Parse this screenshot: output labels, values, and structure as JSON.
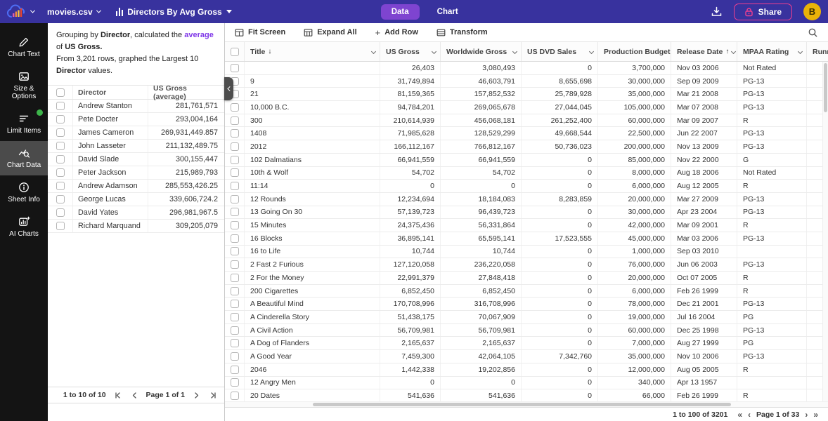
{
  "topbar": {
    "file_name": "movies.csv",
    "chart_name": "Directors By Avg Gross",
    "tabs": [
      {
        "label": "Data",
        "active": true
      },
      {
        "label": "Chart",
        "active": false
      }
    ],
    "share_label": "Share",
    "avatar_initial": "B"
  },
  "sidebar": {
    "items": [
      {
        "label": "Chart Text",
        "icon": "pencil-icon",
        "active": false,
        "badge": false
      },
      {
        "label": "Size & Options",
        "icon": "image-icon",
        "active": false,
        "badge": false
      },
      {
        "label": "Limit Items",
        "icon": "filter-lines-icon",
        "active": false,
        "badge": true
      },
      {
        "label": "Chart Data",
        "icon": "chart-search-icon",
        "active": true,
        "badge": false
      },
      {
        "label": "Sheet Info",
        "icon": "info-icon",
        "active": false,
        "badge": false
      },
      {
        "label": "AI Charts",
        "icon": "ai-chart-icon",
        "active": false,
        "badge": false
      }
    ]
  },
  "summary": {
    "seg1": "Grouping by ",
    "seg2": "Director",
    "seg3": ", calculated the ",
    "seg4": "average",
    "seg5": " of ",
    "seg6": "US Gross",
    "seg7": ".",
    "seg8": "From 3,201 rows, graphed the Largest 10 ",
    "seg9": "Director",
    "seg10": " values."
  },
  "group_table": {
    "columns": [
      "Director",
      "US Gross (average)"
    ],
    "rows": [
      [
        "Andrew Stanton",
        "281,761,571"
      ],
      [
        "Pete Docter",
        "293,004,164"
      ],
      [
        "James Cameron",
        "269,931,449.857"
      ],
      [
        "John Lasseter",
        "211,132,489.75"
      ],
      [
        "David Slade",
        "300,155,447"
      ],
      [
        "Peter Jackson",
        "215,989,793"
      ],
      [
        "Andrew Adamson",
        "285,553,426.25"
      ],
      [
        "George Lucas",
        "339,606,724.2"
      ],
      [
        "David Yates",
        "296,981,967.5"
      ],
      [
        "Richard Marquand",
        "309,205,079"
      ]
    ],
    "pagination": {
      "range": "1 to 10 of 10",
      "page": "Page 1 of 1"
    }
  },
  "toolbar": {
    "buttons": [
      "Fit Screen",
      "Expand All",
      "Add Row",
      "Transform"
    ]
  },
  "data_table": {
    "columns": [
      {
        "label": "Title",
        "sort": "desc"
      },
      {
        "label": "US Gross"
      },
      {
        "label": "Worldwide Gross"
      },
      {
        "label": "US DVD Sales"
      },
      {
        "label": "Production Budget"
      },
      {
        "label": "Release Date",
        "sort": "asc"
      },
      {
        "label": "MPAA Rating"
      },
      {
        "label": "Runn",
        "truncated": true
      }
    ],
    "rows": [
      [
        "",
        "26,403",
        "3,080,493",
        "0",
        "3,700,000",
        "Nov 03 2006",
        "Not Rated",
        ""
      ],
      [
        "9",
        "31,749,894",
        "46,603,791",
        "8,655,698",
        "30,000,000",
        "Sep 09 2009",
        "PG-13",
        ""
      ],
      [
        "21",
        "81,159,365",
        "157,852,532",
        "25,789,928",
        "35,000,000",
        "Mar 21 2008",
        "PG-13",
        ""
      ],
      [
        "10,000 B.C.",
        "94,784,201",
        "269,065,678",
        "27,044,045",
        "105,000,000",
        "Mar 07 2008",
        "PG-13",
        ""
      ],
      [
        "300",
        "210,614,939",
        "456,068,181",
        "261,252,400",
        "60,000,000",
        "Mar 09 2007",
        "R",
        ""
      ],
      [
        "1408",
        "71,985,628",
        "128,529,299",
        "49,668,544",
        "22,500,000",
        "Jun 22 2007",
        "PG-13",
        ""
      ],
      [
        "2012",
        "166,112,167",
        "766,812,167",
        "50,736,023",
        "200,000,000",
        "Nov 13 2009",
        "PG-13",
        ""
      ],
      [
        "102 Dalmatians",
        "66,941,559",
        "66,941,559",
        "0",
        "85,000,000",
        "Nov 22 2000",
        "G",
        ""
      ],
      [
        "10th & Wolf",
        "54,702",
        "54,702",
        "0",
        "8,000,000",
        "Aug 18 2006",
        "Not Rated",
        ""
      ],
      [
        "11:14",
        "0",
        "0",
        "0",
        "6,000,000",
        "Aug 12 2005",
        "R",
        ""
      ],
      [
        "12 Rounds",
        "12,234,694",
        "18,184,083",
        "8,283,859",
        "20,000,000",
        "Mar 27 2009",
        "PG-13",
        ""
      ],
      [
        "13 Going On 30",
        "57,139,723",
        "96,439,723",
        "0",
        "30,000,000",
        "Apr 23 2004",
        "PG-13",
        ""
      ],
      [
        "15 Minutes",
        "24,375,436",
        "56,331,864",
        "0",
        "42,000,000",
        "Mar 09 2001",
        "R",
        ""
      ],
      [
        "16 Blocks",
        "36,895,141",
        "65,595,141",
        "17,523,555",
        "45,000,000",
        "Mar 03 2006",
        "PG-13",
        ""
      ],
      [
        "16 to Life",
        "10,744",
        "10,744",
        "0",
        "1,000,000",
        "Sep 03 2010",
        "",
        ""
      ],
      [
        "2 Fast 2 Furious",
        "127,120,058",
        "236,220,058",
        "0",
        "76,000,000",
        "Jun 06 2003",
        "PG-13",
        ""
      ],
      [
        "2 For the Money",
        "22,991,379",
        "27,848,418",
        "0",
        "20,000,000",
        "Oct 07 2005",
        "R",
        ""
      ],
      [
        "200 Cigarettes",
        "6,852,450",
        "6,852,450",
        "0",
        "6,000,000",
        "Feb 26 1999",
        "R",
        ""
      ],
      [
        "A Beautiful Mind",
        "170,708,996",
        "316,708,996",
        "0",
        "78,000,000",
        "Dec 21 2001",
        "PG-13",
        ""
      ],
      [
        "A Cinderella Story",
        "51,438,175",
        "70,067,909",
        "0",
        "19,000,000",
        "Jul 16 2004",
        "PG",
        ""
      ],
      [
        "A Civil Action",
        "56,709,981",
        "56,709,981",
        "0",
        "60,000,000",
        "Dec 25 1998",
        "PG-13",
        ""
      ],
      [
        "A Dog of Flanders",
        "2,165,637",
        "2,165,637",
        "0",
        "7,000,000",
        "Aug 27 1999",
        "PG",
        ""
      ],
      [
        "A Good Year",
        "7,459,300",
        "42,064,105",
        "7,342,760",
        "35,000,000",
        "Nov 10 2006",
        "PG-13",
        ""
      ],
      [
        "2046",
        "1,442,338",
        "19,202,856",
        "0",
        "12,000,000",
        "Aug 05 2005",
        "R",
        ""
      ],
      [
        "12 Angry Men",
        "0",
        "0",
        "0",
        "340,000",
        "Apr 13 1957",
        "",
        ""
      ],
      [
        "20 Dates",
        "541,636",
        "541,636",
        "0",
        "66,000",
        "Feb 26 1999",
        "R",
        ""
      ]
    ],
    "pagination": {
      "range": "1 to 100 of 3201",
      "page": "Page 1 of 33"
    }
  },
  "colors": {
    "topbar": "#38329E",
    "accent_purple": "#7E44D0",
    "share_pink": "#EF3F8F",
    "avatar_yellow": "#EAB308",
    "status_green": "#3DB54A",
    "summary_highlight": "#8038E8"
  }
}
